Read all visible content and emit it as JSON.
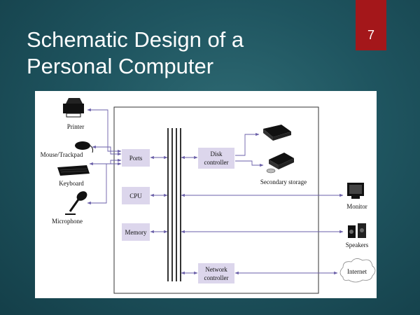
{
  "slide": {
    "title_line1": "Schematic Design of a",
    "title_line2": "Personal Computer",
    "number": "7"
  },
  "diagram": {
    "components": {
      "ports": "Ports",
      "cpu": "CPU",
      "memory": "Memory",
      "disk_controller_line1": "Disk",
      "disk_controller_line2": "controller",
      "network_controller_line1": "Network",
      "network_controller_line2": "controller"
    },
    "devices": {
      "printer": "Printer",
      "mouse": "Mouse/Trackpad",
      "keyboard": "Keyboard",
      "microphone": "Microphone",
      "secondary_storage": "Secondary storage",
      "monitor": "Monitor",
      "speakers": "Speakers",
      "internet": "Internet"
    },
    "colors": {
      "box_fill": "#dcd6ec",
      "arrow": "#6a5fa8",
      "bus": "#000000"
    }
  }
}
